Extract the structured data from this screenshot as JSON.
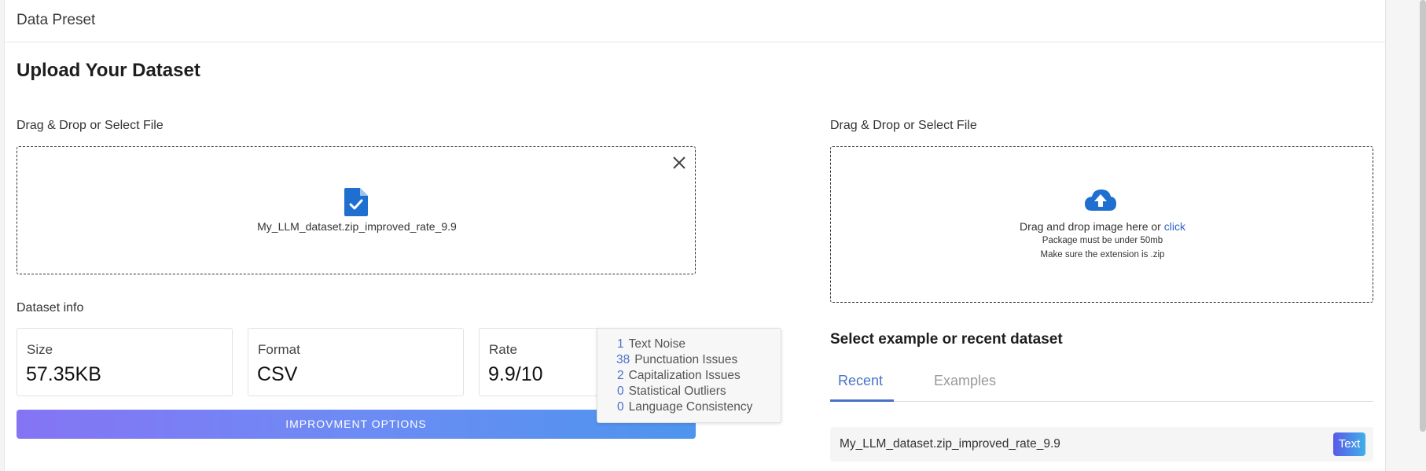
{
  "header": {
    "title": "Data Preset"
  },
  "page": {
    "title": "Upload Your Dataset"
  },
  "left_upload": {
    "label": "Drag & Drop or Select File",
    "file_name": "My_LLM_dataset.zip_improved_rate_9.9"
  },
  "right_upload": {
    "label": "Drag & Drop or Select File",
    "line1_prefix": "Drag and drop image here or ",
    "line1_link": "click",
    "line2": "Package must be under 50mb",
    "line3": "Make sure the extension is .zip"
  },
  "dataset_info": {
    "label": "Dataset info",
    "cards": [
      {
        "key": "Size",
        "value": "57.35KB"
      },
      {
        "key": "Format",
        "value": "CSV"
      },
      {
        "key": "Rate",
        "value": "9.9/10"
      }
    ]
  },
  "improve_button": {
    "label": "IMPROVMENT OPTIONS"
  },
  "issues_tooltip": {
    "items": [
      {
        "count": "1",
        "label": "Text Noise"
      },
      {
        "count": "38",
        "label": "Punctuation Issues"
      },
      {
        "count": "2",
        "label": "Capitalization Issues"
      },
      {
        "count": "0",
        "label": "Statistical Outliers"
      },
      {
        "count": "0",
        "label": "Language Consistency"
      }
    ]
  },
  "recent_section": {
    "title": "Select example or recent dataset",
    "tabs": [
      {
        "label": "Recent",
        "active": true
      },
      {
        "label": "Examples",
        "active": false
      }
    ],
    "items": [
      {
        "name": "My_LLM_dataset.zip_improved_rate_9.9",
        "badge": "Text"
      }
    ]
  },
  "colors": {
    "accent": "#4a72c8",
    "link": "#2e62c8",
    "file_icon": "#1e6fd0",
    "button_gradient_start": "#8574f4",
    "button_gradient_end": "#4d95ee"
  },
  "icons": {
    "close": "close-icon",
    "file_check": "file-check-icon",
    "cloud_upload": "cloud-upload-icon"
  }
}
